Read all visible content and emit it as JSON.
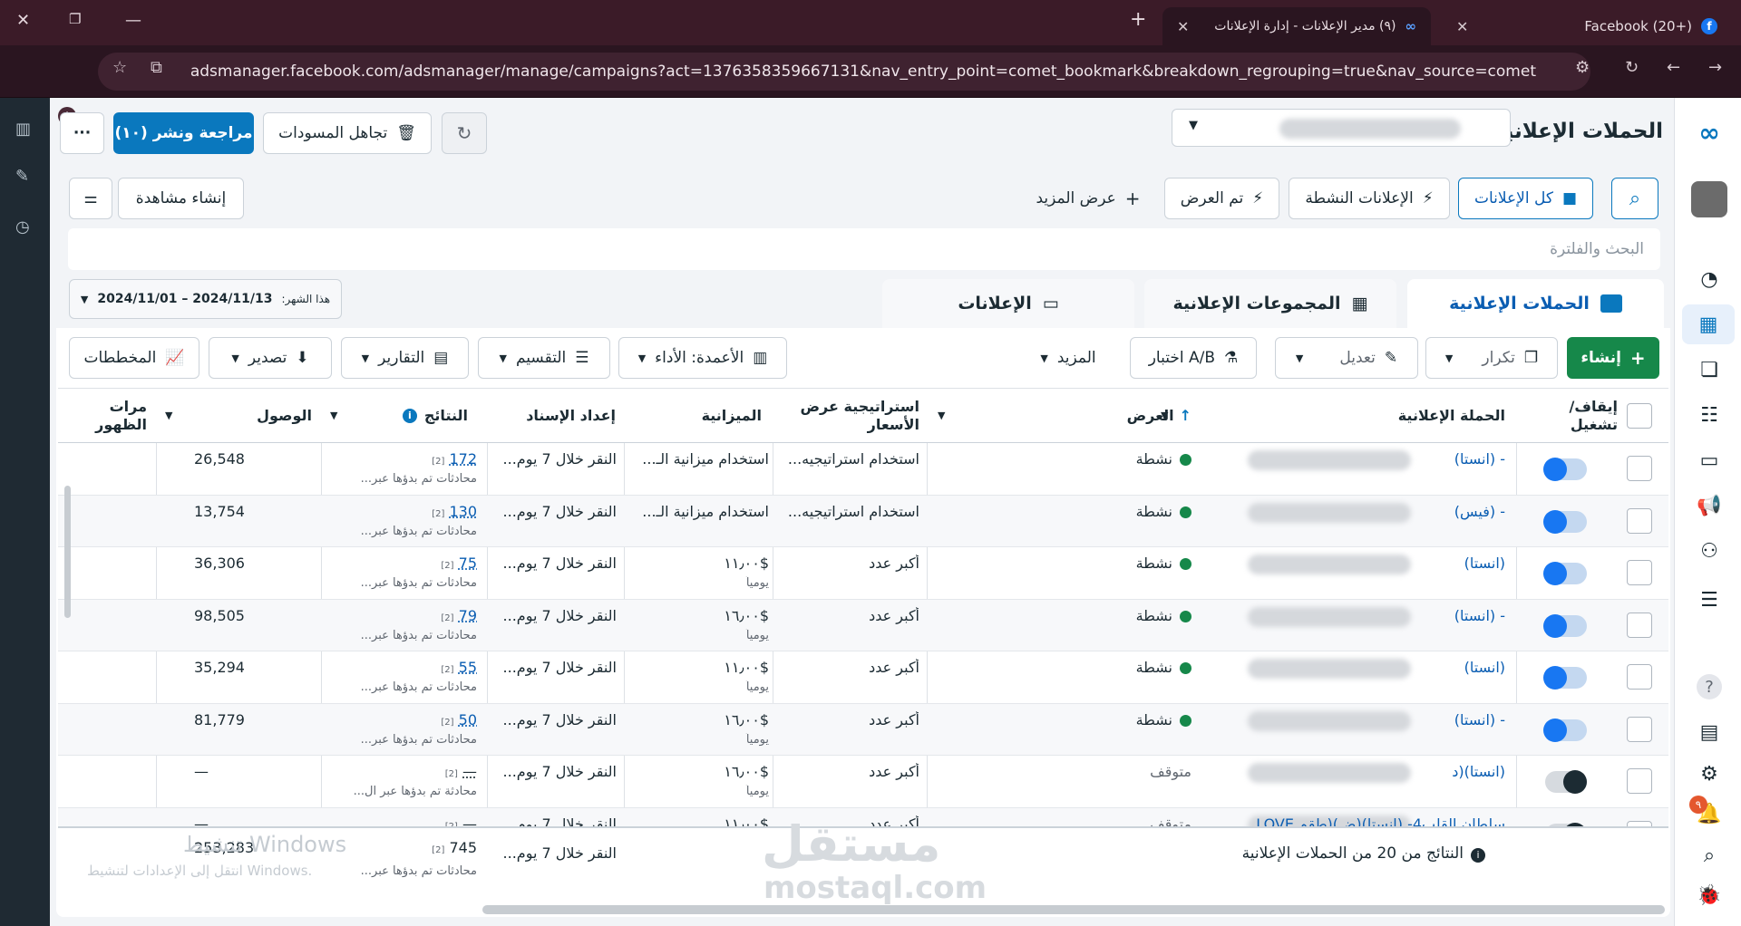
{
  "browser": {
    "tabs": [
      {
        "label": "Facebook (20+)",
        "active": false
      },
      {
        "label": "(٩) مدير الإعلانات - إدارة الإعلانات",
        "active": true
      }
    ],
    "new_tab": "+",
    "url": "adsmanager.facebook.com/adsmanager/manage/campaigns?act=1376358359667131&nav_entry_point=comet_bookmark&breakdown_regrouping=true&nav_source=comet"
  },
  "header": {
    "title": "الحملات الإعلانية",
    "review_publish": "مراجعة ونشر (١٠)",
    "discard_drafts": "تجاهل المسودات",
    "more": "···"
  },
  "filters": {
    "all_ads": "كل الإعلانات",
    "active_ads": "الإعلانات النشطة",
    "delivered": "تم العرض",
    "show_more": "عرض المزيد",
    "create_view": "إنشاء مشاهدة",
    "search_placeholder": "البحث والفلترة",
    "date_prefix": "هذا الشهر:",
    "date_range": "2024/11/01 – 2024/11/13"
  },
  "level_tabs": {
    "campaigns": "الحملات الإعلانية",
    "adsets": "المجموعات الإعلانية",
    "ads": "الإعلانات"
  },
  "toolbar": {
    "create": "إنشاء",
    "duplicate": "تكرار",
    "edit": "تعديل",
    "ab_test": "اختبار A/B",
    "more": "المزيد",
    "columns": "الأعمدة: الأداء",
    "breakdown": "التقسيم",
    "reports": "التقارير",
    "export": "تصدير",
    "charts": "المخططات"
  },
  "columns": {
    "toggle": "إيقاف/ تشغيل",
    "campaign": "الحملة الإعلانية",
    "delivery": "العرض",
    "bid_strategy": "استراتيجية عرض الأسعار",
    "budget": "الميزانية",
    "attribution": "إعداد الإسناد",
    "results": "النتائج",
    "reach": "الوصول",
    "impressions": "مرات الظهور"
  },
  "rows": [
    {
      "name": "- (انستا)",
      "delivery": "نشطة",
      "active": true,
      "bid": "استخدام استراتيجيه...",
      "budget": "استخدام ميزانية الـ...",
      "budget_sub": "",
      "attr": "النقر خلال 7 يوم...",
      "results": "172",
      "res_sub": "محادثات تم بدؤها عبر...",
      "reach": "26,548",
      "on": true
    },
    {
      "name": "- (فيس)",
      "delivery": "نشطة",
      "active": true,
      "bid": "استخدام استراتيجيه...",
      "budget": "استخدام ميزانية الـ...",
      "budget_sub": "",
      "attr": "النقر خلال 7 يوم...",
      "results": "130",
      "res_sub": "محادثات تم بدؤها عبر...",
      "reach": "13,754",
      "on": true
    },
    {
      "name": "(انستا)",
      "delivery": "نشطة",
      "active": true,
      "bid": "أكبر عدد",
      "budget": "$١١٫٠٠",
      "budget_sub": "يومياً",
      "attr": "النقر خلال 7 يوم...",
      "results": "75",
      "res_sub": "محادثات تم بدؤها عبر...",
      "reach": "36,306",
      "on": true
    },
    {
      "name": "- (انستا)",
      "delivery": "نشطة",
      "active": true,
      "bid": "أكبر عدد",
      "budget": "$١٦٫٠٠",
      "budget_sub": "يومياً",
      "attr": "النقر خلال 7 يوم...",
      "results": "79",
      "res_sub": "محادثات تم بدؤها عبر...",
      "reach": "98,505",
      "on": true
    },
    {
      "name": "(انستا)",
      "delivery": "نشطة",
      "active": true,
      "bid": "أكبر عدد",
      "budget": "$١١٫٠٠",
      "budget_sub": "يومياً",
      "attr": "النقر خلال 7 يوم...",
      "results": "55",
      "res_sub": "محادثات تم بدؤها عبر...",
      "reach": "35,294",
      "on": true
    },
    {
      "name": "- (انستا)",
      "delivery": "نشطة",
      "active": true,
      "bid": "أكبر عدد",
      "budget": "$١٦٫٠٠",
      "budget_sub": "يومياً",
      "attr": "النقر خلال 7 يوم...",
      "results": "50",
      "res_sub": "محادثات تم بدؤها عبر...",
      "reach": "81,779",
      "on": true
    },
    {
      "name": "(انستا)(د",
      "delivery": "متوقف",
      "active": false,
      "bid": "أكبر عدد",
      "budget": "$١٦٫٠٠",
      "budget_sub": "يومياً",
      "attr": "النقر خلال 7 يوم...",
      "results": "—",
      "res_sub": "محادثة تم بدؤها عبر ال...",
      "reach": "—",
      "on": false
    },
    {
      "name": "سلطان القلب4- (انستا)(ض)(طقم LOVE",
      "delivery": "متوقف",
      "active": false,
      "bid": "أكبر عدد",
      "budget": "$١١٫٠٠",
      "budget_sub": "",
      "attr": "النقر خلال 7 يوم...",
      "results": "—",
      "res_sub": "",
      "reach": "—",
      "on": false
    }
  ],
  "footer": {
    "summary": "النتائج من 20 من الحملات الإعلانية",
    "attr": "النقر خلال 7 يوم...",
    "results": "745",
    "res_sub": "محادثات تم بدؤها عبر...",
    "reach": "253,283",
    "note_marker": "[2]"
  },
  "watermark": {
    "activate": "تنشيط Windows",
    "activate_sub": "انتقل إلى الإعدادات لتنشيط Windows.",
    "brand_ar": "مستقل",
    "brand_en": "mostaql.com"
  },
  "right_rail_badge": "٩"
}
